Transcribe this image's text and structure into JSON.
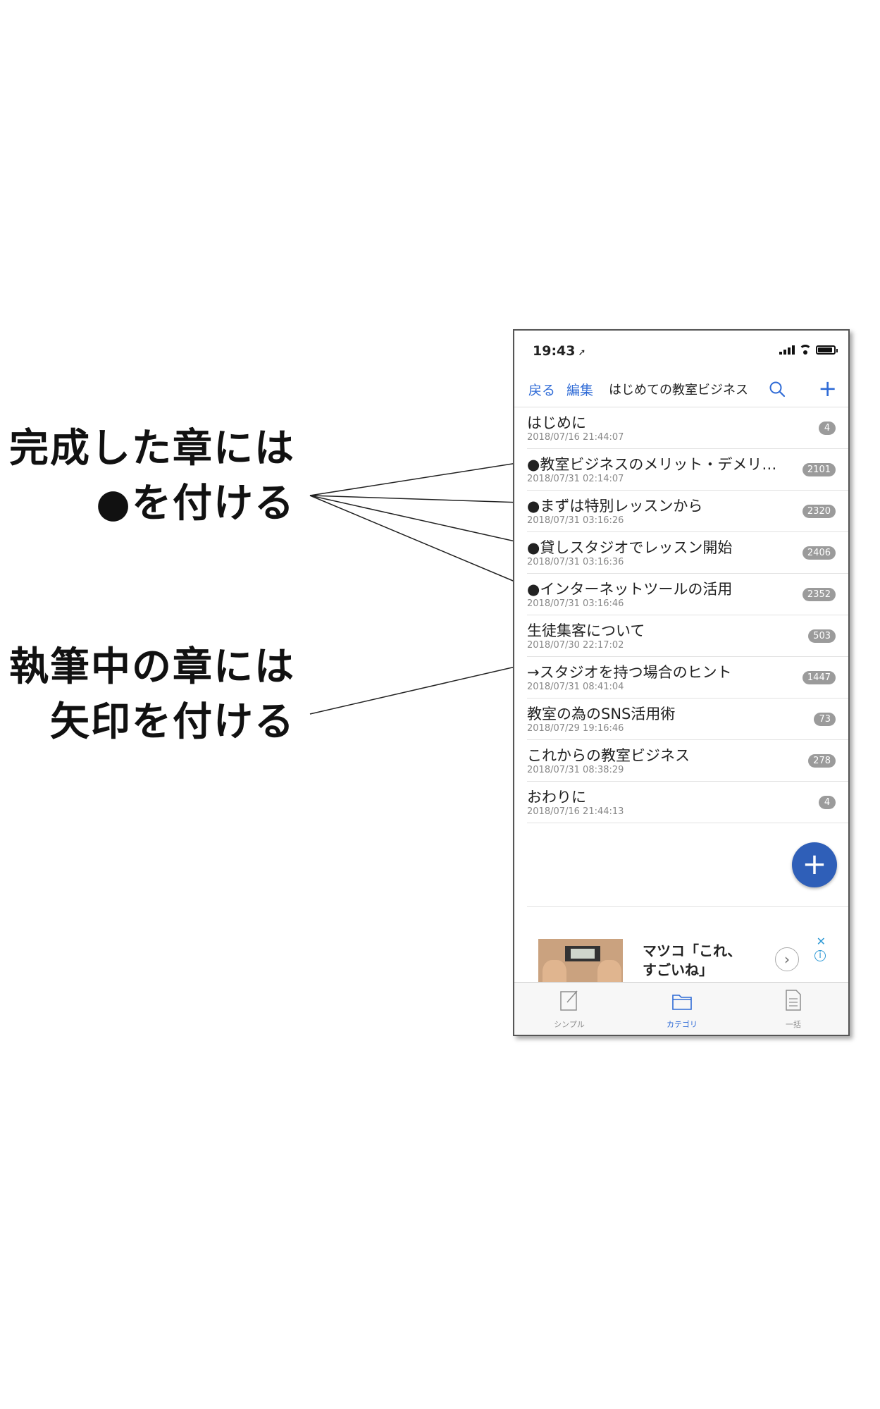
{
  "annotations": {
    "completed": [
      "完成した章には",
      "●を付ける"
    ],
    "in_progress": [
      "執筆中の章には",
      "矢印を付ける"
    ]
  },
  "status_bar": {
    "time": "19:43",
    "location_icon": "location-arrow-icon"
  },
  "nav": {
    "back_label": "戻る",
    "edit_label": "編集",
    "title": "はじめての教室ビジネス",
    "search_icon": "search-icon",
    "add_icon": "plus-icon"
  },
  "rows": [
    {
      "name": "はじめに",
      "date": "2018/07/16 21:44:07",
      "count": "4"
    },
    {
      "name": "●教室ビジネスのメリット・デメリ…",
      "date": "2018/07/31 02:14:07",
      "count": "2101"
    },
    {
      "name": "●まずは特別レッスンから",
      "date": "2018/07/31 03:16:26",
      "count": "2320"
    },
    {
      "name": "●貸しスタジオでレッスン開始",
      "date": "2018/07/31 03:16:36",
      "count": "2406"
    },
    {
      "name": "●インターネットツールの活用",
      "date": "2018/07/31 03:16:46",
      "count": "2352"
    },
    {
      "name": "生徒集客について",
      "date": "2018/07/30 22:17:02",
      "count": "503"
    },
    {
      "name": "→スタジオを持つ場合のヒント",
      "date": "2018/07/31 08:41:04",
      "count": "1447"
    },
    {
      "name": "教室の為のSNS活用術",
      "date": "2018/07/29 19:16:46",
      "count": "73"
    },
    {
      "name": "これからの教室ビジネス",
      "date": "2018/07/31 08:38:29",
      "count": "278"
    },
    {
      "name": "おわりに",
      "date": "2018/07/16 21:44:13",
      "count": "4"
    }
  ],
  "fab": {
    "label": "+"
  },
  "ad": {
    "line1": "マツコ「これ、",
    "line2": "すごいね」",
    "arrow": "›",
    "close": "✕",
    "info": "i"
  },
  "tabs": [
    {
      "label": "シンプル",
      "icon": "pencil-note-icon",
      "active": false
    },
    {
      "label": "カテゴリ",
      "icon": "folder-icon",
      "active": true
    },
    {
      "label": "一括",
      "icon": "document-icon",
      "active": false
    }
  ],
  "colors": {
    "accent": "#2f6bd6",
    "fab": "#2f5fb8",
    "badge": "#9b9b9b"
  }
}
